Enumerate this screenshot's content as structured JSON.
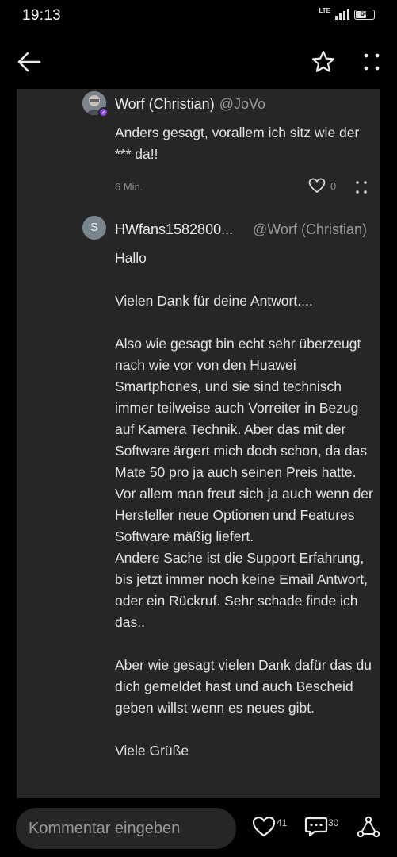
{
  "status_bar": {
    "time": "19:13",
    "network": "LTE",
    "battery": "64"
  },
  "topbar": {
    "back_icon": "arrow-left-icon",
    "favorite_icon": "star-outline-icon",
    "more_icon": "more-vertical-icon"
  },
  "comments": [
    {
      "author": "Worf (Christian)",
      "handle": "@JoVo",
      "text": "Anders gesagt, vorallem ich sitz wie der *** da!!",
      "time": "6 Min.",
      "likes": "0",
      "badge_color": "#8b4fe0"
    },
    {
      "avatar_letter": "S",
      "author": "HWfans1582800...",
      "reply_to": "@Worf (Christian)",
      "paragraphs": [
        "Hallo",
        "Vielen Dank für deine Antwort....",
        "Also wie gesagt bin echt sehr überzeugt nach wie vor von den Huawei Smartphones, und sie sind technisch immer teilweise auch Vorreiter in Bezug auf Kamera Technik. Aber das mit der Software ärgert mich doch schon, da das Mate 50 pro ja auch seinen Preis hatte. Vor allem man freut sich ja auch wenn der Hersteller neue Optionen und Features Software mäßig liefert.",
        "Andere Sache ist die Support Erfahrung, bis jetzt immer noch keine Email Antwort, oder ein Rückruf. Sehr schade finde ich das..",
        "Aber wie gesagt vielen Dank dafür das du dich gemeldet hast und auch Bescheid geben willst wenn es neues gibt.",
        "Viele Grüße"
      ]
    }
  ],
  "bottom_bar": {
    "input_placeholder": "Kommentar eingeben",
    "likes": "41",
    "comments": "30"
  },
  "colors": {
    "background": "#000000",
    "card": "#262626",
    "text": "#e2e2e2",
    "muted": "#8c8c8c"
  }
}
